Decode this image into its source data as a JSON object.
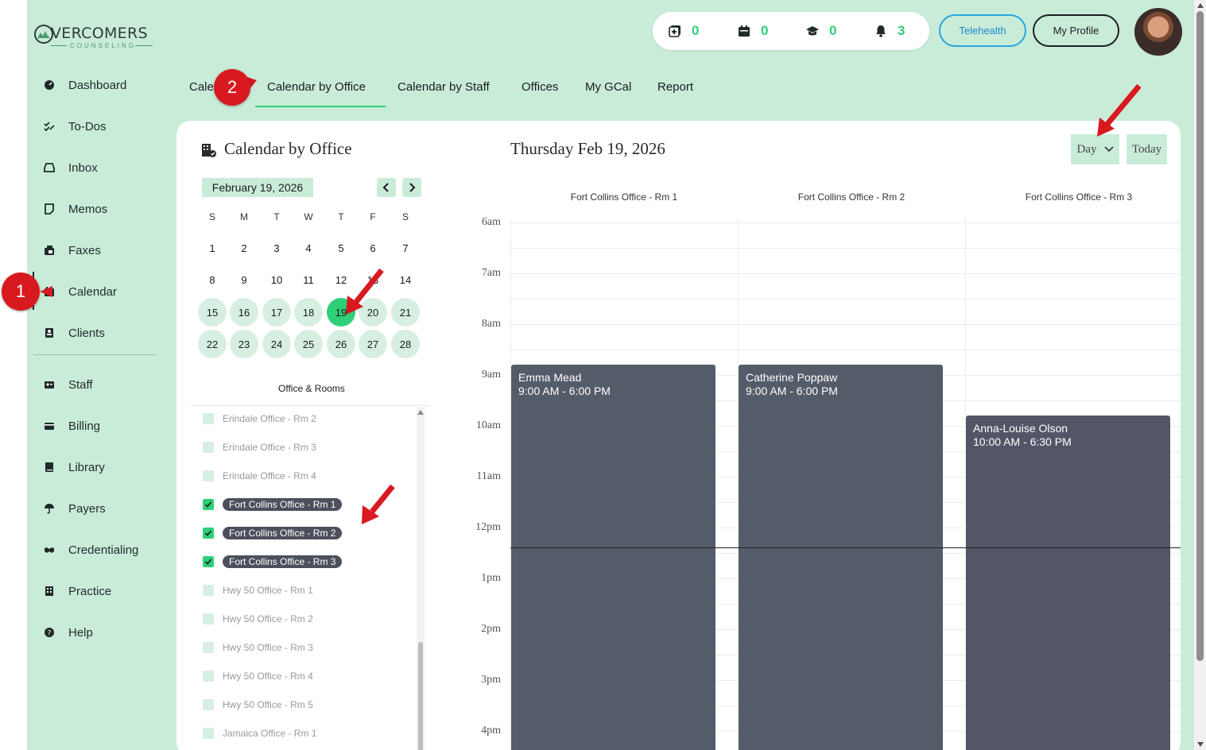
{
  "logo": {
    "word": "VERCOMERS",
    "tagline": "COUNSELING"
  },
  "sidebar": {
    "items": [
      {
        "label": "Dashboard",
        "icon": "dashboard-icon"
      },
      {
        "label": "To-Dos",
        "icon": "checks-icon"
      },
      {
        "label": "Inbox",
        "icon": "inbox-icon"
      },
      {
        "label": "Memos",
        "icon": "memo-icon"
      },
      {
        "label": "Faxes",
        "icon": "fax-icon"
      },
      {
        "label": "Calendar",
        "icon": "calendar-icon",
        "active": true
      },
      {
        "label": "Clients",
        "icon": "clients-icon"
      },
      {
        "label": "Staff",
        "icon": "staff-icon"
      },
      {
        "label": "Billing",
        "icon": "billing-icon"
      },
      {
        "label": "Library",
        "icon": "library-icon"
      },
      {
        "label": "Payers",
        "icon": "umbrella-icon"
      },
      {
        "label": "Credentialing",
        "icon": "handshake-icon"
      },
      {
        "label": "Practice",
        "icon": "building-icon"
      },
      {
        "label": "Help",
        "icon": "help-icon"
      }
    ]
  },
  "header": {
    "counters": [
      {
        "icon": "add-note-icon",
        "value": "0"
      },
      {
        "icon": "calendar-icon",
        "value": "0"
      },
      {
        "icon": "graduation-cap-icon",
        "value": "0"
      },
      {
        "icon": "bell-icon",
        "value": "3"
      }
    ],
    "telehealth_label": "Telehealth",
    "profile_label": "My Profile"
  },
  "tabs": [
    {
      "label": "Calendar"
    },
    {
      "label": "Calendar by Office",
      "active": true
    },
    {
      "label": "Calendar by Staff"
    },
    {
      "label": "Offices"
    },
    {
      "label": "My GCal"
    },
    {
      "label": "Report"
    }
  ],
  "card": {
    "title": "Calendar by Office",
    "date_title": "Thursday Feb 19, 2026",
    "view_label": "Day",
    "today_label": "Today"
  },
  "mini_calendar": {
    "month_label": "February 19, 2026",
    "weekdays": [
      "S",
      "M",
      "T",
      "W",
      "T",
      "F",
      "S"
    ],
    "weeks": [
      [
        "1",
        "2",
        "3",
        "4",
        "5",
        "6",
        "7"
      ],
      [
        "8",
        "9",
        "10",
        "11",
        "12",
        "13",
        "14"
      ],
      [
        "15",
        "16",
        "17",
        "18",
        "19",
        "20",
        "21"
      ],
      [
        "22",
        "23",
        "24",
        "25",
        "26",
        "27",
        "28"
      ]
    ],
    "selected": "19"
  },
  "rooms": {
    "title": "Office & Rooms",
    "items": [
      {
        "name": "Erindale Office - Rm 2",
        "checked": false
      },
      {
        "name": "Erindale Office - Rm 3",
        "checked": false
      },
      {
        "name": "Erindale Office - Rm 4",
        "checked": false
      },
      {
        "name": "Fort Collins Office - Rm 1",
        "checked": true
      },
      {
        "name": "Fort Collins Office - Rm 2",
        "checked": true
      },
      {
        "name": "Fort Collins Office - Rm 3",
        "checked": true
      },
      {
        "name": "Hwy 50 Office - Rm 1",
        "checked": false
      },
      {
        "name": "Hwy 50 Office - Rm 2",
        "checked": false
      },
      {
        "name": "Hwy 50 Office - Rm 3",
        "checked": false
      },
      {
        "name": "Hwy 50 Office - Rm 4",
        "checked": false
      },
      {
        "name": "Hwy 50 Office - Rm 5",
        "checked": false
      },
      {
        "name": "Jamaica Office - Rm 1",
        "checked": false
      }
    ]
  },
  "day_view": {
    "columns": [
      "Fort Collins Office - Rm 1",
      "Fort Collins Office - Rm 2",
      "Fort Collins Office - Rm 3"
    ],
    "hours": [
      "6am",
      "7am",
      "8am",
      "9am",
      "10am",
      "11am",
      "12pm",
      "1pm",
      "2pm",
      "3pm",
      "4pm"
    ],
    "events": [
      {
        "column": 0,
        "name": "Emma Mead",
        "time": "9:00 AM - 6:00 PM",
        "start_hour": 9.0
      },
      {
        "column": 1,
        "name": "Catherine Poppaw",
        "time": "9:00 AM - 6:00 PM",
        "start_hour": 9.0
      },
      {
        "column": 2,
        "name": "Anna-Louise Olson",
        "time": "10:00 AM - 6:30 PM",
        "start_hour": 10.0
      }
    ],
    "current_time_hour": 12.4
  },
  "annotations": [
    {
      "label": "1"
    },
    {
      "label": "2"
    }
  ],
  "colors": {
    "accent": "#2fcf78",
    "background": "#c9ecd9",
    "event": "#555c69"
  }
}
